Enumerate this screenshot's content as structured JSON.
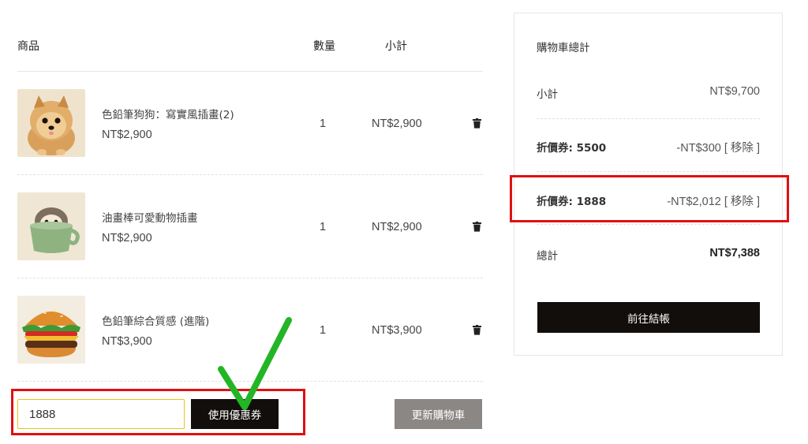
{
  "table": {
    "col_product": "商品",
    "col_qty": "數量",
    "col_subtotal": "小計"
  },
  "items": [
    {
      "name": "色鉛筆狗狗：寫實風插畫(2)",
      "price": "NT$2,900",
      "qty": "1",
      "subtotal": "NT$2,900",
      "image": "pomeranian-dog"
    },
    {
      "name": "油畫棒可愛動物插畫",
      "price": "NT$2,900",
      "qty": "1",
      "subtotal": "NT$2,900",
      "image": "hedgehog-in-cup"
    },
    {
      "name": "色鉛筆綜合質感 (進階)",
      "price": "NT$3,900",
      "qty": "1",
      "subtotal": "NT$3,900",
      "image": "hamburger"
    }
  ],
  "coupon": {
    "input_value": "1888",
    "apply_label": "使用優惠券"
  },
  "update_cart_label": "更新購物車",
  "totals": {
    "title": "購物車總計",
    "subtotal_label": "小計",
    "subtotal_value": "NT$9,700",
    "coupons": [
      {
        "label": "折價券: 5500",
        "amount": "-NT$300",
        "remove": "[ 移除 ]"
      },
      {
        "label": "折價券: 1888",
        "amount": "-NT$2,012",
        "remove": "[ 移除 ]"
      }
    ],
    "total_label": "總計",
    "total_value": "NT$7,388",
    "checkout_label": "前往結帳"
  },
  "colors": {
    "highlight": "#e01010",
    "checkmark": "#22b526",
    "button_dark": "#120e0b",
    "button_grey": "#8a8785",
    "input_border": "#e8c21c"
  }
}
